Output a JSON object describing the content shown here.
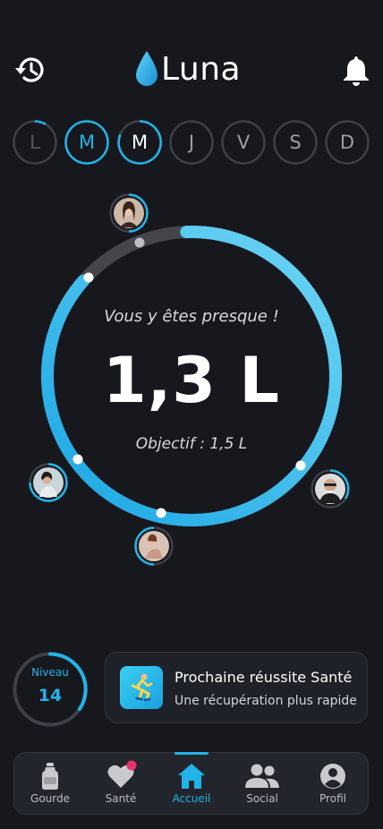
{
  "header": {
    "app_name": "Luna",
    "history_icon": "history-icon",
    "notification_icon": "bell-icon"
  },
  "week": {
    "days": [
      {
        "label": "L",
        "state": "past-partial",
        "progress": 0.15
      },
      {
        "label": "M",
        "state": "past-complete",
        "progress": 1.0
      },
      {
        "label": "M",
        "state": "today",
        "progress": 0.85
      },
      {
        "label": "J",
        "state": "future",
        "progress": 0
      },
      {
        "label": "V",
        "state": "future",
        "progress": 0
      },
      {
        "label": "S",
        "state": "future",
        "progress": 0
      },
      {
        "label": "D",
        "state": "future",
        "progress": 0
      }
    ]
  },
  "hydration": {
    "message": "Vous y êtes presque !",
    "current": "1,3 L",
    "goal_text": "Objectif : 1,5 L",
    "progress_fraction": 0.87
  },
  "friends": [
    {
      "name": "friend-1",
      "progress": 0.5
    },
    {
      "name": "friend-2",
      "progress": 0.75
    },
    {
      "name": "friend-3",
      "progress": 0.5
    },
    {
      "name": "friend-4",
      "progress": 0.6
    }
  ],
  "level": {
    "label": "Niveau",
    "value": "14",
    "progress_fraction": 0.4
  },
  "achievement": {
    "title": "Prochaine réussite Santé",
    "subtitle": "Une récupération plus rapide",
    "icon": "runner-icon"
  },
  "nav": {
    "items": [
      {
        "label": "Gourde",
        "icon": "bottle-icon",
        "active": false
      },
      {
        "label": "Santé",
        "icon": "heart-icon",
        "active": false,
        "badge": true
      },
      {
        "label": "Accueil",
        "icon": "home-icon",
        "active": true
      },
      {
        "label": "Social",
        "icon": "people-icon",
        "active": false
      },
      {
        "label": "Profil",
        "icon": "profile-icon",
        "active": false
      }
    ]
  },
  "colors": {
    "background": "#17181e",
    "accent": "#21b4e8",
    "accent_light": "#6fd6f4",
    "track": "#45464c",
    "badge": "#e8336a"
  }
}
